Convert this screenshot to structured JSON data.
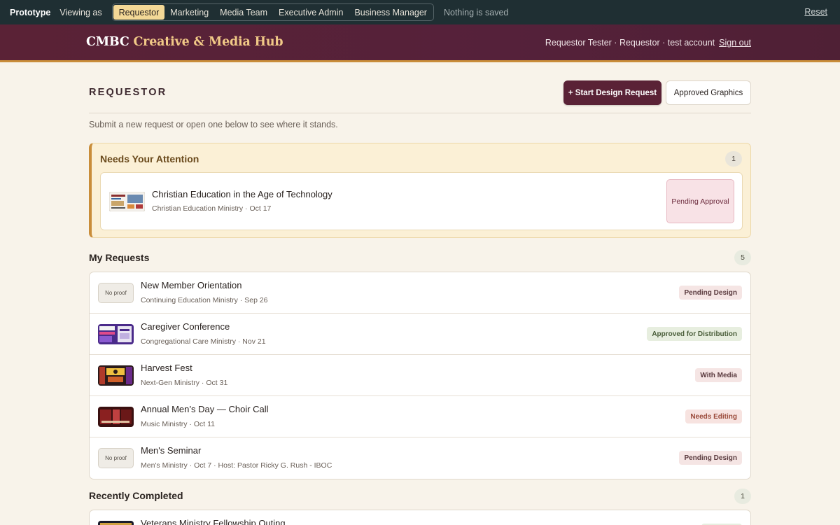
{
  "protobar": {
    "prototype_label": "Prototype",
    "viewing_as": "Viewing as",
    "roles": [
      {
        "label": "Requestor",
        "active": true
      },
      {
        "label": "Marketing",
        "active": false
      },
      {
        "label": "Media Team",
        "active": false
      },
      {
        "label": "Executive Admin",
        "active": false
      },
      {
        "label": "Business Manager",
        "active": false
      }
    ],
    "save_status": "Nothing is saved",
    "reset_label": "Reset"
  },
  "header": {
    "brand_main": "CMBC",
    "brand_accent": "Creative & Media Hub",
    "user_info": "Requestor Tester · Requestor · test account",
    "sign_out": "Sign out"
  },
  "page": {
    "title": "REQUESTOR",
    "start_button": "+ Start Design Request",
    "approved_button": "Approved Graphics",
    "intro": "Submit a new request or open one below to see where it stands."
  },
  "attention": {
    "title": "Needs Your Attention",
    "count": "1",
    "item": {
      "title": "Christian Education in the Age of Technology",
      "meta": "Christian Education Ministry · Oct 17",
      "status": "Pending Approval"
    }
  },
  "my_requests": {
    "title": "My Requests",
    "count": "5",
    "no_proof_label": "No proof",
    "items": [
      {
        "title": "New Member Orientation",
        "meta": "Continuing Education Ministry · Sep 26",
        "status": "Pending Design",
        "proof": false
      },
      {
        "title": "Caregiver Conference",
        "meta": "Congregational Care Ministry · Nov 21",
        "status": "Approved for Distribution",
        "proof": true
      },
      {
        "title": "Harvest Fest",
        "meta": "Next-Gen Ministry · Oct 31",
        "status": "With Media",
        "proof": true
      },
      {
        "title": "Annual Men’s Day — Choir Call",
        "meta": "Music Ministry · Oct 11",
        "status": "Needs Editing",
        "proof": true
      },
      {
        "title": "Men's Seminar",
        "meta": "Men's Ministry · Oct 7 · Host: Pastor Ricky G. Rush - IBOC",
        "status": "Pending Design",
        "proof": false
      }
    ]
  },
  "recently_completed": {
    "title": "Recently Completed",
    "count": "1",
    "items": [
      {
        "title": "Veterans Ministry Fellowship Outing"
      }
    ]
  },
  "colors": {
    "brand_maroon": "#5a2236",
    "accent_gold": "#c98d3a",
    "background": "#f8f3ea"
  }
}
